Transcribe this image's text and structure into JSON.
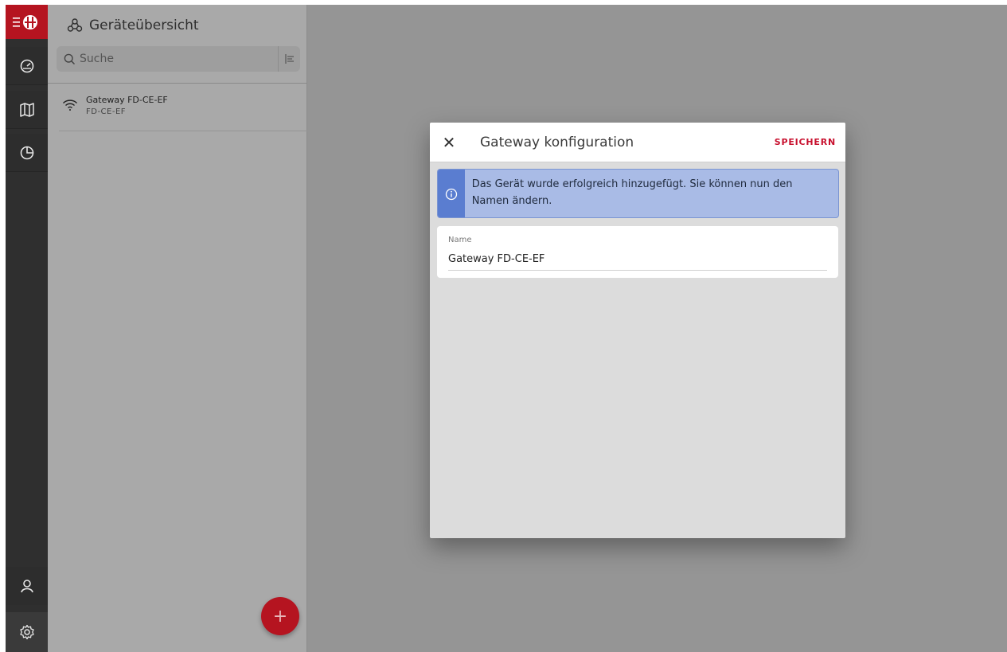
{
  "sidebar": {
    "items": [
      {
        "icon": "dashboard-gauge-icon"
      },
      {
        "icon": "map-icon"
      },
      {
        "icon": "pie-chart-icon"
      },
      {
        "icon": "user-icon"
      },
      {
        "icon": "settings-gear-icon"
      }
    ],
    "brand_color": "#b51420"
  },
  "device_panel": {
    "title": "Geräteübersicht",
    "title_icon": "devices-icon",
    "search": {
      "placeholder": "Suche",
      "value": ""
    },
    "filter_icon": "filter-icon",
    "devices": [
      {
        "name": "Gateway FD-CE-EF",
        "id": "FD-CE-EF",
        "icon": "wifi-icon"
      }
    ],
    "fab_label": "+"
  },
  "dialog": {
    "close_label": "✕",
    "title": "Gateway konfiguration",
    "save_label": "SPEICHERN",
    "info_message": "Das Gerät wurde erfolgreich hinzugefügt. Sie können nun den Namen ändern.",
    "info_icon": "info-icon",
    "name_field": {
      "label": "Name",
      "value": "Gateway FD-CE-EF"
    },
    "accent_color": "#c8102e",
    "info_color": "#a9bbe6"
  }
}
